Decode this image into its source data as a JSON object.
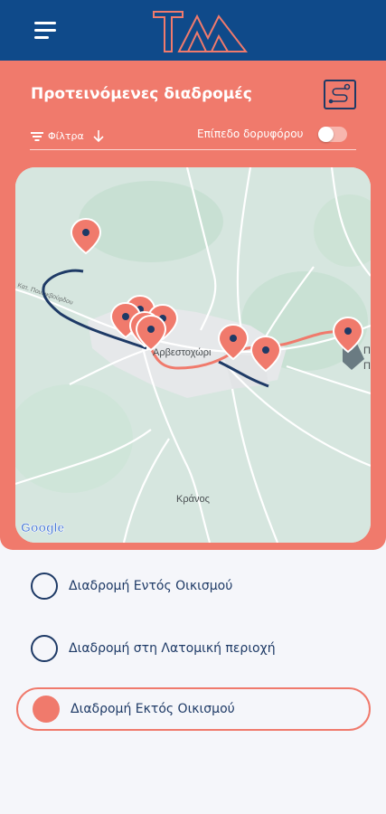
{
  "header": {
    "menu_icon": "hamburger-menu-icon",
    "logo_icon": "tm-logo-icon",
    "brand_color": "#0f4a8a"
  },
  "panel": {
    "title": "Προτεινόμενες διαδρομές",
    "route_icon": "route-map-icon",
    "filters_label": "Φίλτρα",
    "filter_icon": "filter-funnel-icon",
    "sort_icon": "arrow-down-icon",
    "satellite_label": "Επίπεδο δορυφόρου",
    "satellite_enabled": false,
    "accent_color": "#f07a6c"
  },
  "map": {
    "place_labels": [
      "Αρβεστοχώρι",
      "Κράνος",
      "Π",
      "Π"
    ],
    "road_label": "Κατ. Πουλικβούρδου",
    "attribution": "Google",
    "marker_icon": "map-pin-icon",
    "marker_count": 9
  },
  "route_options": [
    {
      "label": "Διαδρομή Εντός Οικισμού",
      "selected": false
    },
    {
      "label": "Διαδρομή στη Λατομική περιοχή",
      "selected": false
    },
    {
      "label": "Διαδρομή Εκτός Οικισμού",
      "selected": true
    }
  ],
  "colors": {
    "route_blue": "#1e3a66",
    "route_coral": "#f07a6c"
  }
}
